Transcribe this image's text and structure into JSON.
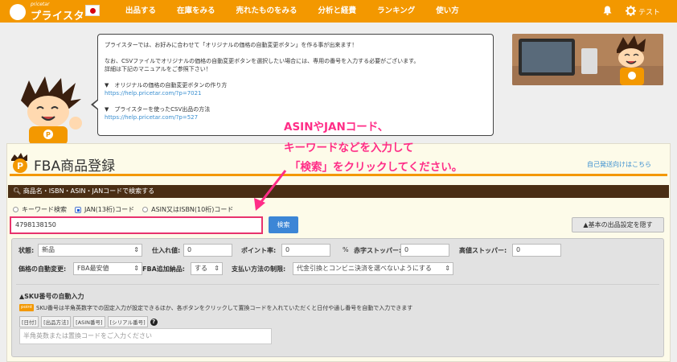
{
  "header": {
    "logo_sub": "pricetar",
    "logo_main": "プライスター",
    "nav": [
      "出品する",
      "在庫をみる",
      "売れたものをみる",
      "分析と経費",
      "ランキング",
      "使い方"
    ],
    "user": "テスト"
  },
  "bubble": {
    "line1": "プライスターでは、お好みに合わせて「オリジナルの価格の自動変更ボタン」を作る事が出来ます！",
    "line2": "なお、CSVファイルでオリジナルの価格の自動変更ボタンを選択したい場合には、専用の番号を入力する必要がございます。",
    "line3": "詳細は下記のマニュアルをご参照下さい！",
    "item1": "▼　オリジナルの価格の自動変更ボタンの作り方",
    "link1": "https://help.pricetar.com/?p=7021",
    "item2": "▼　プライスターを使ったCSV出品の方法",
    "link2": "https://help.pricetar.com/?p=527"
  },
  "annotation": {
    "line1": "ASINやJANコード、",
    "line2": "キーワードなどを入力して",
    "line3": "「検索」をクリックしてください。"
  },
  "panel": {
    "title": "FBA商品登録",
    "right_link": "自己発送向けはこちら",
    "search_bar": "商品名・ISBN・ASIN・JANコードで検索する",
    "radios": [
      "キーワード検索",
      "JAN(13桁)コード",
      "ASIN又はISBN(10桁)コード"
    ],
    "search_value": "4798138150",
    "search_button": "検索",
    "hide_button": "▲基本の出品設定を隠す"
  },
  "settings": {
    "condition_label": "状態:",
    "condition_value": "新品",
    "cost_label": "仕入れ値:",
    "cost_value": "0",
    "point_label": "ポイント率:",
    "point_value": "0",
    "percent": "%",
    "red_stopper_label": "赤字ストッパー:",
    "red_stopper_value": "0",
    "high_stopper_label": "高値ストッパー:",
    "high_stopper_value": "0",
    "auto_price_label": "価格の自動変更:",
    "auto_price_value": "FBA最安値",
    "fba_extra_label": "FBA追加納品:",
    "fba_extra_value": "する",
    "payment_label": "支払い方法の制限:",
    "payment_value": "代金引換とコンビニ決済を選べないようにする",
    "sku_title": "▲SKU番号の自動入力",
    "point_badge": "point",
    "sku_desc": "SKU番号は半角英数字での固定入力が設定できるほか、各ボタンをクリックして置換コードを入れていただくと日付や通し番号を自動で入力できます",
    "tags": [
      "[日付]",
      "[出品方法]",
      "[ASIN番号]",
      "[シリアル番号]"
    ],
    "sku_placeholder": "半角英数または置換コードをご入力ください"
  }
}
